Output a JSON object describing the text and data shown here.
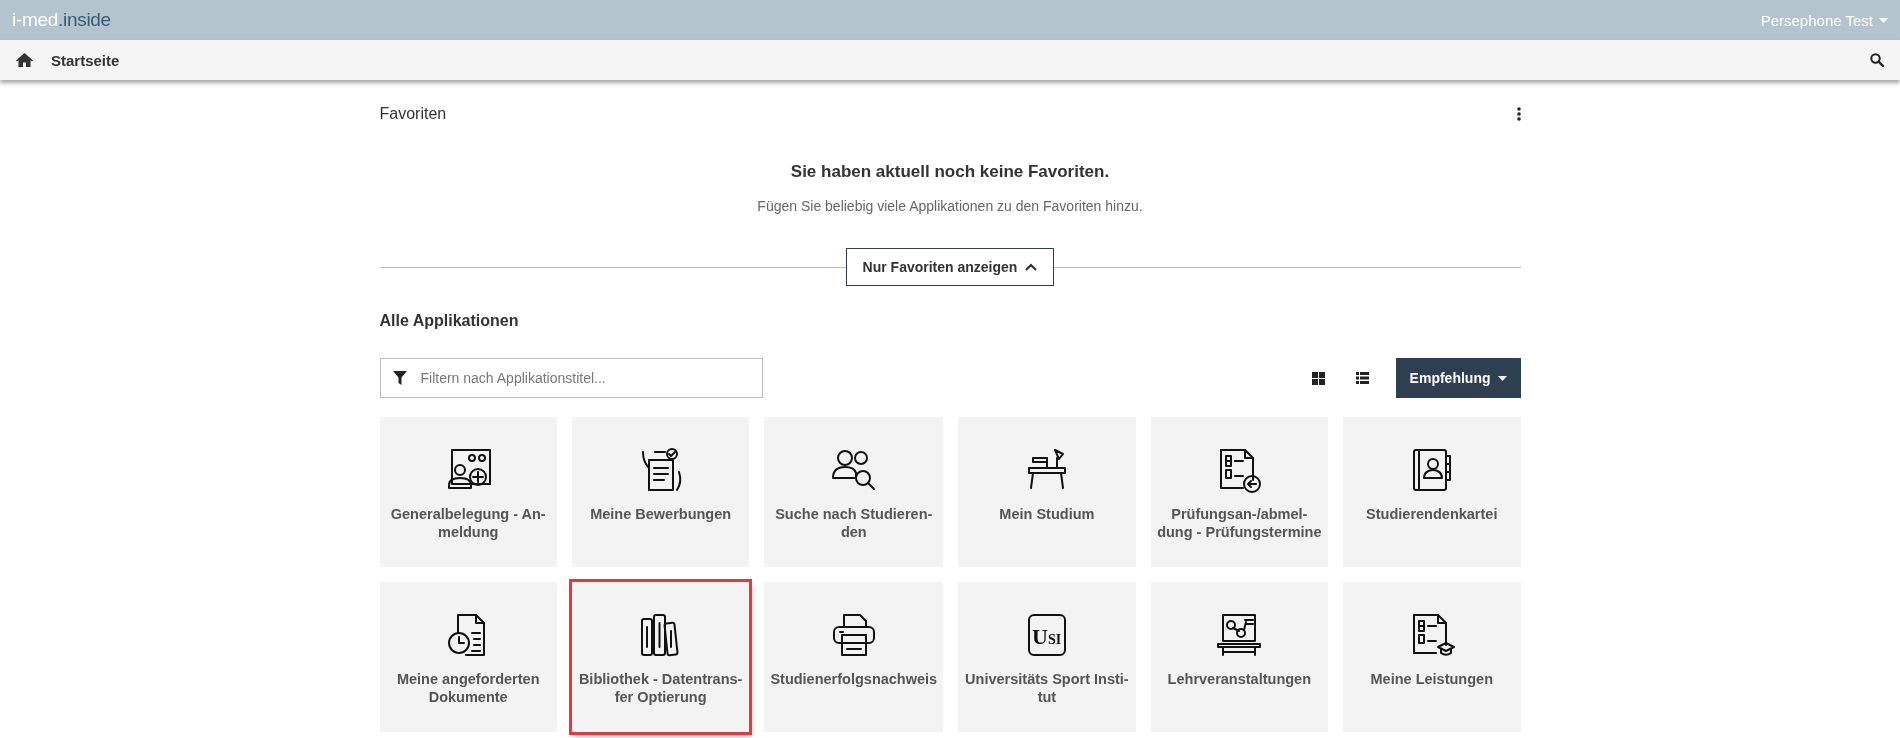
{
  "top_bar": {
    "logo": {
      "prefix": "i-med",
      "suffix": ".inside"
    },
    "user_menu": "Persephone Test"
  },
  "nav_bar": {
    "breadcrumb": "Startseite"
  },
  "favorites": {
    "title": "Favoriten",
    "empty_title": "Sie haben aktuell noch keine Favoriten.",
    "empty_text": "Fügen Sie beliebig viele Applikationen zu den Favoriten hinzu.",
    "toggle_button": "Nur Favoriten anzeigen",
    "expanded": true
  },
  "applications": {
    "title": "Alle Applikationen",
    "filter": {
      "placeholder": "Filtern nach Applikationstitel..."
    },
    "sort_button": "Empfehlung",
    "tiles": [
      {
        "kind": "enrol",
        "lines": [
          "Generalbelegung - An-",
          "meldung"
        ],
        "selected": false
      },
      {
        "kind": "application",
        "lines": [
          "Meine Bewerbungen"
        ],
        "selected": false
      },
      {
        "kind": "people-search",
        "lines": [
          "Suche nach Studieren-",
          "den"
        ],
        "selected": false
      },
      {
        "kind": "desk",
        "lines": [
          "Mein Studium"
        ],
        "selected": false
      },
      {
        "kind": "exam-out",
        "lines": [
          "Prüfungsan-/abmel-",
          "dung - Prüfungstermine"
        ],
        "selected": false
      },
      {
        "kind": "address-book",
        "lines": [
          "Studierendenkartei"
        ],
        "selected": false
      },
      {
        "kind": "document-clock",
        "lines": [
          "Meine angeforderten",
          "Dokumente"
        ],
        "selected": false
      },
      {
        "kind": "books",
        "lines": [
          "Bibliothek - Datentrans-",
          "fer Optierung"
        ],
        "selected": true
      },
      {
        "kind": "printer",
        "lines": [
          "Studienerfolgsnachweis"
        ],
        "selected": false
      },
      {
        "kind": "usi",
        "lines": [
          "Universitäts Sport Insti-",
          "tut"
        ],
        "selected": false,
        "icon_text": [
          "U",
          "SI"
        ]
      },
      {
        "kind": "lecture",
        "lines": [
          "Lehrveranstaltungen"
        ],
        "selected": false
      },
      {
        "kind": "exam-grad",
        "lines": [
          "Meine Leistungen"
        ],
        "selected": false
      }
    ]
  }
}
